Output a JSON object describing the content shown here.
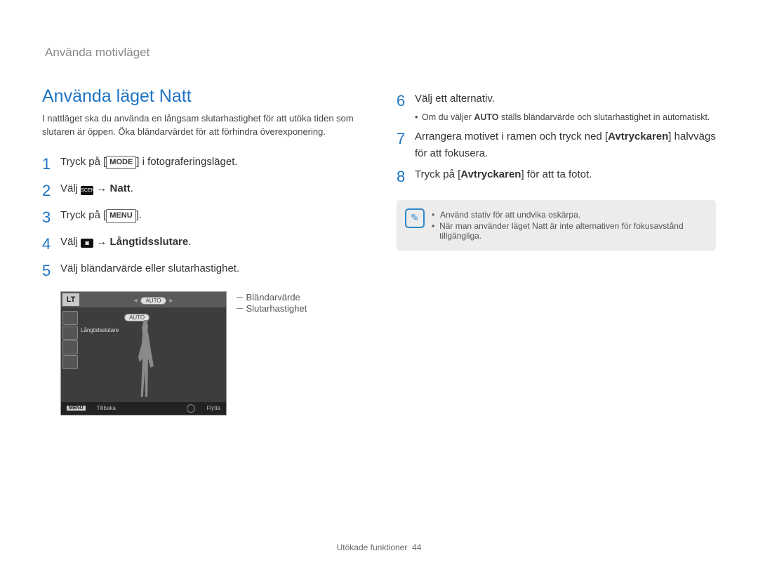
{
  "breadcrumb": "Använda motivläget",
  "title": "Använda läget Natt",
  "intro": "I nattläget ska du använda en långsam slutarhastighet för att utöka tiden som slutaren är öppen. Öka bländarvärdet för att förhindra överexponering.",
  "steps_left": {
    "1": {
      "pre": "Tryck på [",
      "btn": "MODE",
      "post": "] i fotograferingsläget."
    },
    "2": {
      "pre": "Välj ",
      "arrow": "→",
      "bold": "Natt",
      "post": "."
    },
    "3": {
      "pre": "Tryck på [",
      "btn": "MENU",
      "post": "]."
    },
    "4": {
      "pre": "Välj ",
      "arrow": "→",
      "bold": "Långtidsslutare",
      "post": "."
    },
    "5": {
      "text": "Välj bländarvärde eller slutarhastighet."
    }
  },
  "camera": {
    "lt": "LT",
    "auto": "AUTO",
    "longtext": "Långtidsslutare",
    "back": "Tillbaka",
    "move": "Flytta",
    "menu": "MENU"
  },
  "annotations": {
    "a": "Bländarvärde",
    "b": "Slutarhastighet"
  },
  "steps_right": {
    "6": {
      "text": "Välj ett alternativ.",
      "sub": {
        "pre": "Om du väljer ",
        "bold": "AUTO",
        "post": " ställs bländarvärde och slutarhastighet in automatiskt."
      }
    },
    "7": {
      "pre": "Arrangera motivet i ramen och tryck ned [",
      "bold": "Avtryckaren",
      "post": "] halvvägs för att fokusera."
    },
    "8": {
      "pre": "Tryck på [",
      "bold": "Avtryckaren",
      "post": "] för att ta fotot."
    }
  },
  "note": {
    "a": "Använd stativ för att undvika oskärpa.",
    "b": "När man använder läget Natt är inte alternativen för fokusavstånd tillgängliga."
  },
  "footer": {
    "section": "Utökade funktioner",
    "page": "44"
  }
}
